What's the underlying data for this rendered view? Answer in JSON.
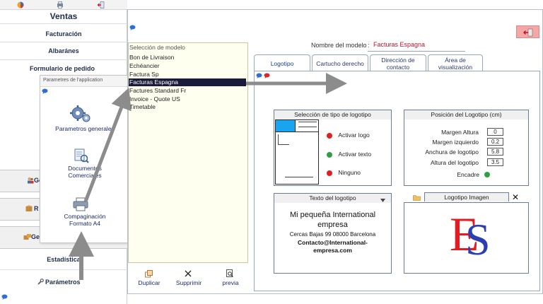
{
  "sidebar": {
    "title": "Ventas",
    "items": {
      "facturacion": "Facturación",
      "albaranes": "Albaránes",
      "formulario": "Formulario de pedido",
      "ge1": "Ge",
      "r": "R",
      "ge2": "Ge",
      "estadistica": "Estadística",
      "parametros": "Parámetros"
    }
  },
  "popup": {
    "title": "Parametres de l'application",
    "items": {
      "general": "Parametros generales",
      "documentos_1": "Documentos",
      "documentos_2": "Comerciales",
      "compag_1": "Compaginación",
      "compag_2": "Formato A4"
    }
  },
  "models": {
    "caption": "Selección de modelo",
    "list": [
      "Bon de Livraison",
      "Echéancier",
      "Factura Sp",
      "Facturas  Espagna",
      "Factures Standard Fr",
      "Invoice - Quote US",
      "Timetable"
    ],
    "selected_index": 3,
    "buttons": {
      "duplicar": "Duplicar",
      "suprimir": "Supprimir",
      "previa": "previa"
    }
  },
  "model_name": {
    "label": "Nombre del modelo",
    "sep": ":",
    "value": "Facturas  Espagna"
  },
  "tabs": [
    {
      "label": "Logotipo",
      "active": true
    },
    {
      "label": "Cartucho derecho"
    },
    {
      "label_1": "Dirección de",
      "label_2": "contacto"
    },
    {
      "label_1": "Área de",
      "label_2": "visualización"
    }
  ],
  "logo_type": {
    "title": "Selección de tipo de logotipo",
    "options": [
      {
        "label": "Activar logo",
        "color": "#e02020"
      },
      {
        "label": "Activar texto",
        "color": "#2ea043"
      },
      {
        "label": "Ninguno",
        "color": "#e02020"
      }
    ]
  },
  "logo_position": {
    "title": "Posición del Logotipo (cm)",
    "fields": [
      {
        "label": "Margen Altura",
        "value": "0"
      },
      {
        "label": "Margen izquierdo",
        "value": "0.2"
      },
      {
        "label": "Anchura de logotipo",
        "value": "5.8"
      },
      {
        "label": "Altura del logotipo",
        "value": "3.5"
      }
    ],
    "encadre_label": "Encadre",
    "encadre_color": "#2ea043"
  },
  "logo_text": {
    "title": "Texto del logotipo",
    "line1": "Mi pequeña International",
    "line2": "empresa",
    "line3": "Cercas Bajas 99 08000  Barcelona",
    "line4": "Contacto@International-",
    "line5": "empresa.com"
  },
  "logo_image": {
    "title": "Logotipo Imagen",
    "close": "✕",
    "letter_e": "E",
    "letter_s": "S"
  },
  "colors": {
    "accent_red": "#c0122a",
    "selection": "#1a1a3a",
    "list_bg": "#fffff0",
    "arrow": "#8c8c8c"
  }
}
